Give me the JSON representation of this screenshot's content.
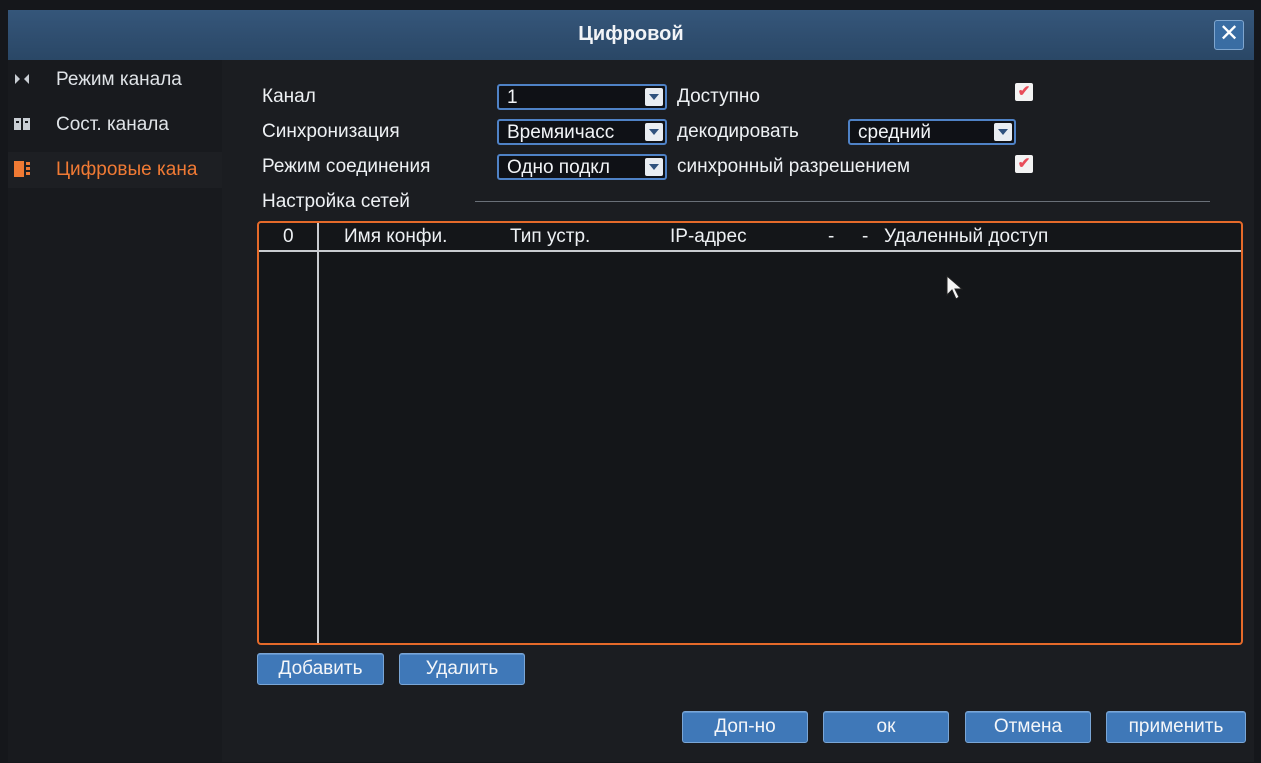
{
  "window": {
    "title": "Цифровой",
    "close_glyph": "✕"
  },
  "sidebar": {
    "items": [
      {
        "label": "Режим канала",
        "icon": "channel-mode-icon"
      },
      {
        "label": "Сост. канала",
        "icon": "channel-status-icon"
      },
      {
        "label": "Цифровые кана",
        "icon": "digital-channels-icon",
        "active": true
      }
    ]
  },
  "form": {
    "channel_label": "Канал",
    "channel_value": "1",
    "available_label": "Доступно",
    "available_checked": true,
    "sync_label": "Синхронизация",
    "sync_value": "Времяичасс",
    "decode_label": "декодировать",
    "decode_value": "средний",
    "connect_mode_label": "Режим соединения",
    "connect_mode_value": "Одно подкл",
    "sync_resolution_label": "синхронный  разрешением",
    "sync_resolution_checked": true,
    "network_section_label": "Настройка сетей"
  },
  "table": {
    "columns": [
      "0",
      "Имя конфи.",
      "Тип устр.",
      "IP-адрес",
      "-",
      "-",
      "Удаленный доступ"
    ],
    "rows": []
  },
  "buttons": {
    "add": "Добавить",
    "delete": "Удалить",
    "advanced": "Доп-но",
    "ok": "ок",
    "cancel": "Отмена",
    "apply": "применить"
  },
  "colors": {
    "accent": "#e56a2a",
    "button": "#3f78b8",
    "titlebar": "#2f4f72"
  }
}
